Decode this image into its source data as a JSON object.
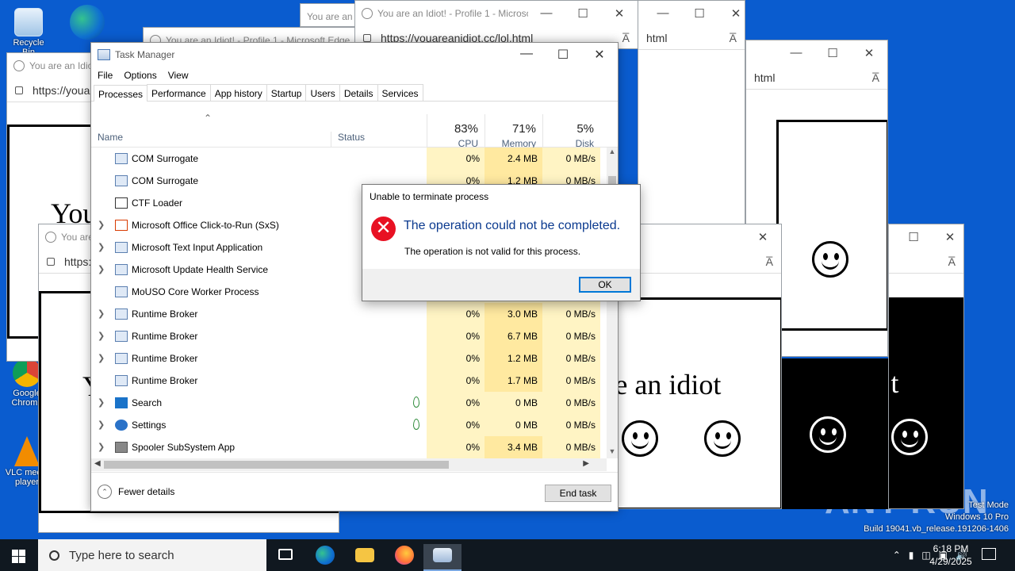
{
  "desktop": {
    "icons": [
      {
        "label": "Recycle Bin"
      },
      {
        "label": "Microsoft Edge"
      },
      {
        "label": "Google Chrome"
      },
      {
        "label": "VLC media player"
      }
    ],
    "watermark": {
      "line1": "Test Mode",
      "line2": "Windows 10 Pro",
      "line3": "Build 19041.vb_release.191206-1406",
      "brand": "ANY RUN"
    }
  },
  "browser": {
    "title": "You are an Idiot! - Profile 1 - Microsoft Edge",
    "title_short": "You are an Idiot",
    "url": "https://youareanidiot.cc/lol.html",
    "url_fragment": "html",
    "idiot_text": "You are an idiot",
    "read_aloud": "A̅"
  },
  "taskmgr": {
    "title": "Task Manager",
    "menu": [
      "File",
      "Options",
      "View"
    ],
    "tabs": [
      "Processes",
      "Performance",
      "App history",
      "Startup",
      "Users",
      "Details",
      "Services"
    ],
    "columns": {
      "name": "Name",
      "status": "Status",
      "cpu_pct": "83%",
      "cpu_label": "CPU",
      "mem_pct": "71%",
      "mem_label": "Memory",
      "disk_pct": "5%",
      "disk_label": "Disk"
    },
    "processes": [
      {
        "name": "COM Surrogate",
        "cpu": "0%",
        "mem": "2.4 MB",
        "disk": "0 MB/s",
        "expand": false,
        "icon": "window-icon"
      },
      {
        "name": "COM Surrogate",
        "cpu": "0%",
        "mem": "1.2 MB",
        "disk": "0 MB/s",
        "expand": false,
        "icon": "window-icon"
      },
      {
        "name": "CTF Loader",
        "cpu": "",
        "mem": "",
        "disk": "",
        "expand": false,
        "icon": "pen-icon"
      },
      {
        "name": "Microsoft Office Click-to-Run (SxS)",
        "cpu": "",
        "mem": "",
        "disk": "",
        "expand": true,
        "icon": "office-icon"
      },
      {
        "name": "Microsoft Text Input Application",
        "cpu": "",
        "mem": "",
        "disk": "",
        "expand": true,
        "icon": "window-icon"
      },
      {
        "name": "Microsoft Update Health Service",
        "cpu": "",
        "mem": "",
        "disk": "",
        "expand": true,
        "icon": "window-icon"
      },
      {
        "name": "MoUSO Core Worker Process",
        "cpu": "",
        "mem": "",
        "disk": "",
        "expand": false,
        "icon": "window-icon"
      },
      {
        "name": "Runtime Broker",
        "cpu": "0%",
        "mem": "3.0 MB",
        "disk": "0 MB/s",
        "expand": true,
        "icon": "window-icon"
      },
      {
        "name": "Runtime Broker",
        "cpu": "0%",
        "mem": "6.7 MB",
        "disk": "0 MB/s",
        "expand": true,
        "icon": "window-icon"
      },
      {
        "name": "Runtime Broker",
        "cpu": "0%",
        "mem": "1.2 MB",
        "disk": "0 MB/s",
        "expand": true,
        "icon": "window-icon"
      },
      {
        "name": "Runtime Broker",
        "cpu": "0%",
        "mem": "1.7 MB",
        "disk": "0 MB/s",
        "expand": false,
        "icon": "window-icon"
      },
      {
        "name": "Search",
        "cpu": "0%",
        "mem": "0 MB",
        "disk": "0 MB/s",
        "expand": true,
        "icon": "search-icon",
        "suspended": true
      },
      {
        "name": "Settings",
        "cpu": "0%",
        "mem": "0 MB",
        "disk": "0 MB/s",
        "expand": true,
        "icon": "gear-icon",
        "suspended": true
      },
      {
        "name": "Spooler SubSystem App",
        "cpu": "0%",
        "mem": "3.4 MB",
        "disk": "0 MB/s",
        "expand": true,
        "icon": "printer-icon"
      }
    ],
    "fewer_details": "Fewer details",
    "end_task": "End task"
  },
  "dialog": {
    "title": "Unable to terminate process",
    "main": "The operation could not be completed.",
    "sub": "The operation is not valid for this process.",
    "ok": "OK"
  },
  "taskbar": {
    "search_placeholder": "Type here to search",
    "time": "6:18 PM",
    "date": "4/29/2025"
  }
}
